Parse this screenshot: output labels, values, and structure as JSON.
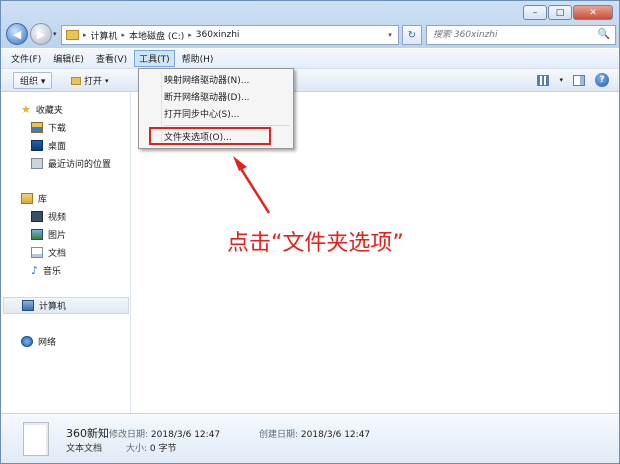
{
  "window": {
    "controls": {
      "minimize": "–",
      "maximize": "□",
      "close": "✕"
    }
  },
  "nav": {
    "back_icon": "◀",
    "forward_icon": "▶",
    "recent_icon": "▾"
  },
  "address": {
    "segments": [
      "计算机",
      "本地磁盘 (C:)",
      "360xinzhi"
    ],
    "separator": "▸",
    "dropdown_icon": "▾"
  },
  "refresh_icon": "↻",
  "search": {
    "placeholder": "搜索 360xinzhi",
    "icon": "🔍"
  },
  "menubar": {
    "file": "文件(F)",
    "edit": "编辑(E)",
    "view": "查看(V)",
    "tools": "工具(T)",
    "help": "帮助(H)"
  },
  "toolbar": {
    "organize": "组织 ▾",
    "open": "打开",
    "open_caret": "▾",
    "views_caret": "▾",
    "help": "?"
  },
  "tools_menu": {
    "items": [
      "映射网络驱动器(N)...",
      "断开网络驱动器(D)...",
      "打开同步中心(S)...",
      "文件夹选项(O)..."
    ]
  },
  "navpane": {
    "favorites": "收藏夹",
    "downloads": "下载",
    "desktop": "桌面",
    "recent": "最近访问的位置",
    "libraries": "库",
    "videos": "视频",
    "pictures": "图片",
    "documents": "文档",
    "music": "音乐",
    "computer": "计算机",
    "network": "网络"
  },
  "annotation": {
    "text": "点击“文件夹选项”",
    "color": "#e4211c"
  },
  "details": {
    "name": "360新知",
    "modified_label": "修改日期:",
    "modified_value": "2018/3/6 12:47",
    "created_label": "创建日期:",
    "created_value": "2018/3/6 12:47",
    "type": "文本文档",
    "size_label": "大小:",
    "size_value": "0 字节"
  }
}
